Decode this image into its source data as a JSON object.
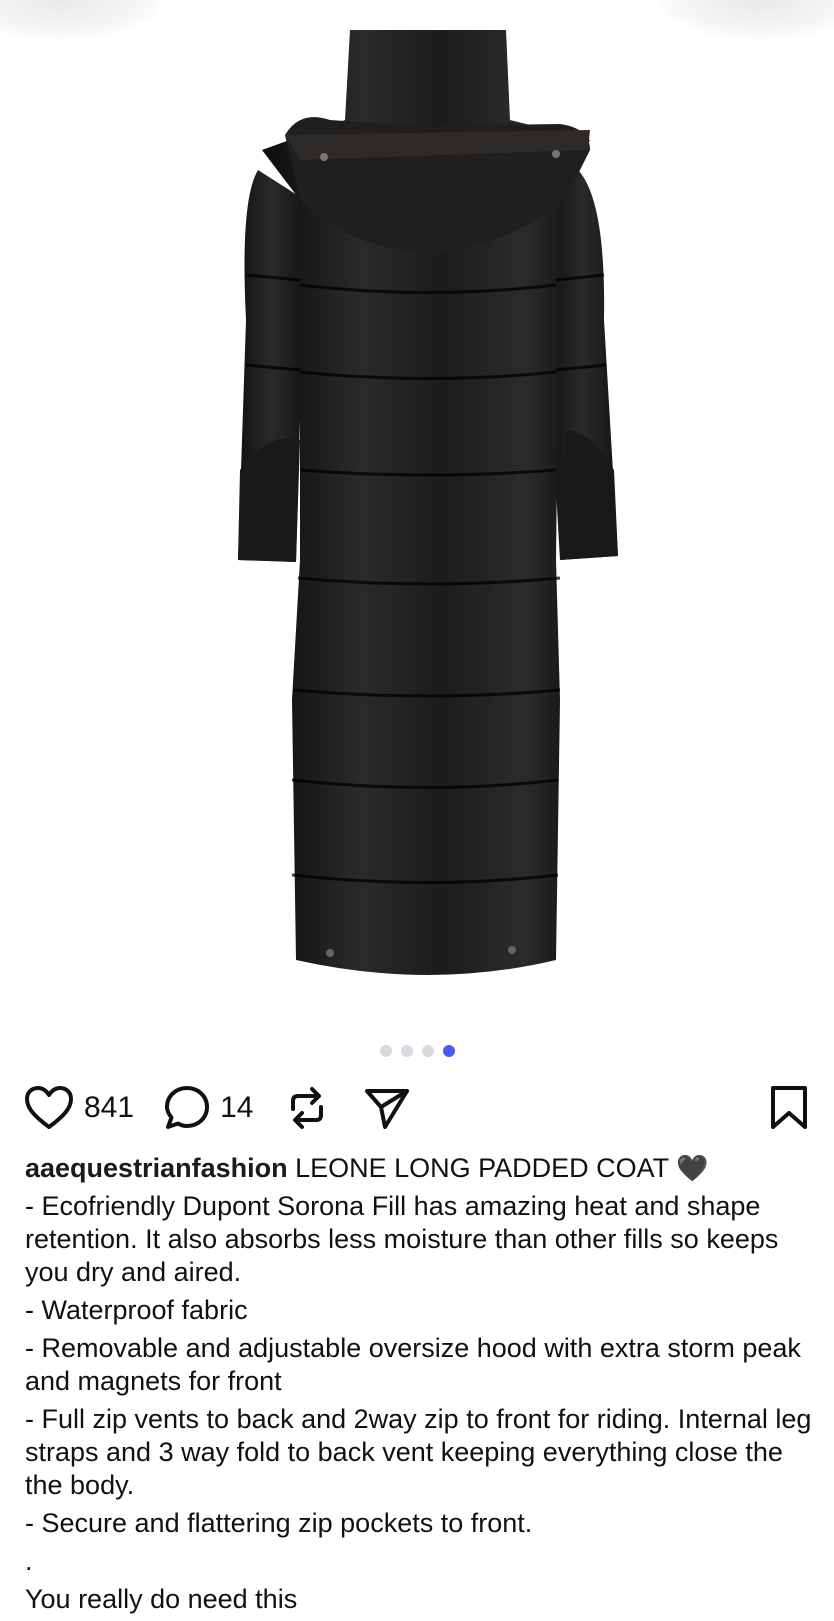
{
  "post": {
    "image_alt": "Black long padded coat, back view",
    "carousel": {
      "count": 4,
      "active_index": 3
    }
  },
  "actions": {
    "likes": "841",
    "comments": "14"
  },
  "caption": {
    "username": "aaequestrianfashion",
    "headline": "LEONE LONG PADDED COAT",
    "emoji": "🖤",
    "lines": [
      "- Ecofriendly Dupont Sorona Fill has amazing heat and shape retention. It also absorbs less moisture than other fills so keeps you dry and aired.",
      "- Waterproof fabric",
      "- Removable and adjustable oversize hood with extra storm peak and magnets for front",
      "- Full zip vents to back and 2way zip to front for riding. Internal leg straps and 3 way fold to back vent keeping everything close the the body.",
      "- Secure and flattering zip pockets to front.",
      ".",
      "You really do need this"
    ]
  },
  "colors": {
    "accent_dot": "#4a5cf0",
    "inactive_dot": "#d9d9df",
    "coat": "#161616"
  },
  "icons": [
    "heart-icon",
    "comment-icon",
    "repost-icon",
    "share-icon",
    "bookmark-icon"
  ]
}
